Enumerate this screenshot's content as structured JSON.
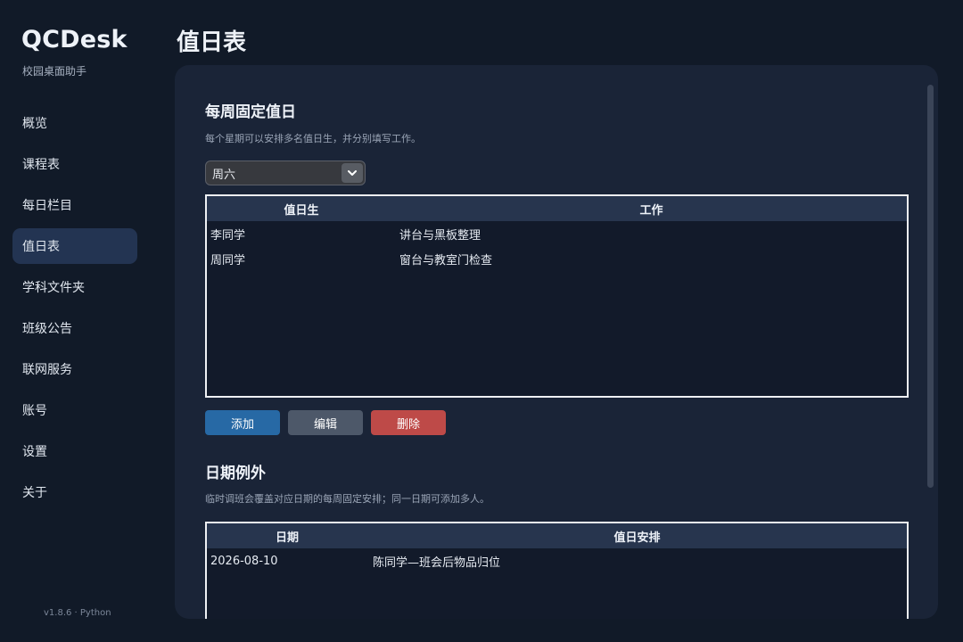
{
  "app": {
    "title": "QCDesk",
    "subtitle": "校园桌面助手",
    "version": "v1.8.6 · Python"
  },
  "nav": {
    "items": [
      {
        "label": "概览"
      },
      {
        "label": "课程表"
      },
      {
        "label": "每日栏目"
      },
      {
        "label": "值日表",
        "active": true
      },
      {
        "label": "学科文件夹"
      },
      {
        "label": "班级公告"
      },
      {
        "label": "联网服务"
      },
      {
        "label": "账号"
      },
      {
        "label": "设置"
      },
      {
        "label": "关于"
      }
    ]
  },
  "page": {
    "title": "值日表"
  },
  "weekly": {
    "title": "每周固定值日",
    "description": "每个星期可以安排多名值日生，并分别填写工作。",
    "day_select": {
      "value": "周六",
      "icon": "chevron-down-icon"
    },
    "table": {
      "headers": [
        "值日生",
        "工作"
      ],
      "rows": [
        [
          "李同学",
          "讲台与黑板整理"
        ],
        [
          "周同学",
          "窗台与教室门检查"
        ]
      ]
    },
    "buttons": {
      "add": "添加",
      "edit": "编辑",
      "delete": "删除"
    }
  },
  "exceptions": {
    "title": "日期例外",
    "description": "临时调班会覆盖对应日期的每周固定安排；同一日期可添加多人。",
    "table": {
      "headers": [
        "日期",
        "值日安排"
      ],
      "rows": [
        [
          "2026-08-10",
          "陈同学—班会后物品归位"
        ]
      ]
    }
  },
  "colors": {
    "accent": "#2769a5",
    "danger": "#be4a48",
    "active_nav": "#233452"
  }
}
